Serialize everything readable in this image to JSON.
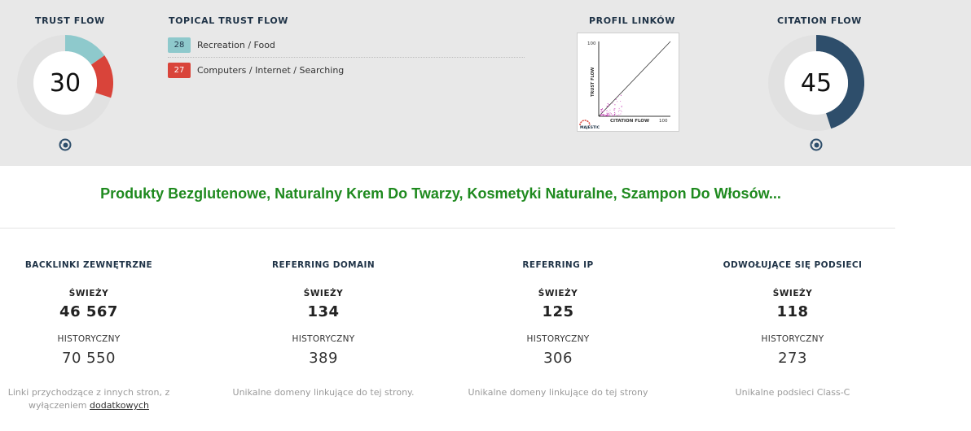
{
  "trust_flow": {
    "header": "TRUST FLOW",
    "value": "30",
    "segments": [
      28,
      27
    ]
  },
  "topical_trust_flow": {
    "header": "TOPICAL TRUST FLOW",
    "items": [
      {
        "score": "28",
        "label": "Recreation / Food",
        "color": "#8ec9cc"
      },
      {
        "score": "27",
        "label": "Computers / Internet / Searching",
        "color": "#d9443a"
      }
    ]
  },
  "profile": {
    "header": "PROFIL LINKÓW",
    "y_axis_label": "TRUST FLOW",
    "x_axis_label": "CITATION FLOW",
    "y_max": "100",
    "x_max": "100",
    "brand": "MAJESTIC"
  },
  "citation_flow": {
    "header": "CITATION FLOW",
    "value": "45"
  },
  "site_title": "Produkty Bezglutenowe, Naturalny Krem Do Twarzy, Kosmetyki Naturalne, Szampon Do Włosów...",
  "stats": [
    {
      "header": "BACKLINKI ZEWNĘTRZNE",
      "fresh_label": "ŚWIEŻY",
      "fresh": "46 567",
      "hist_label": "HISTORYCZNY",
      "hist": "70 550",
      "desc": "Linki przychodzące z innych stron, z wyłączeniem",
      "desc_link": "dodatkowych"
    },
    {
      "header": "REFERRING DOMAIN",
      "fresh_label": "ŚWIEŻY",
      "fresh": "134",
      "hist_label": "HISTORYCZNY",
      "hist": "389",
      "desc": "Unikalne domeny linkujące do tej strony."
    },
    {
      "header": "REFERRING IP",
      "fresh_label": "ŚWIEŻY",
      "fresh": "125",
      "hist_label": "HISTORYCZNY",
      "hist": "306",
      "desc": "Unikalne domeny linkujące do tej strony"
    },
    {
      "header": "ODWOŁUJĄCE SIĘ PODSIECI",
      "fresh_label": "ŚWIEŻY",
      "fresh": "118",
      "hist_label": "HISTORYCZNY",
      "hist": "273",
      "desc": "Unikalne podsieci Class-C"
    }
  ],
  "colors": {
    "citation": "#2e4e6b",
    "track": "#e1e1e1",
    "title": "#1f8a1f"
  }
}
